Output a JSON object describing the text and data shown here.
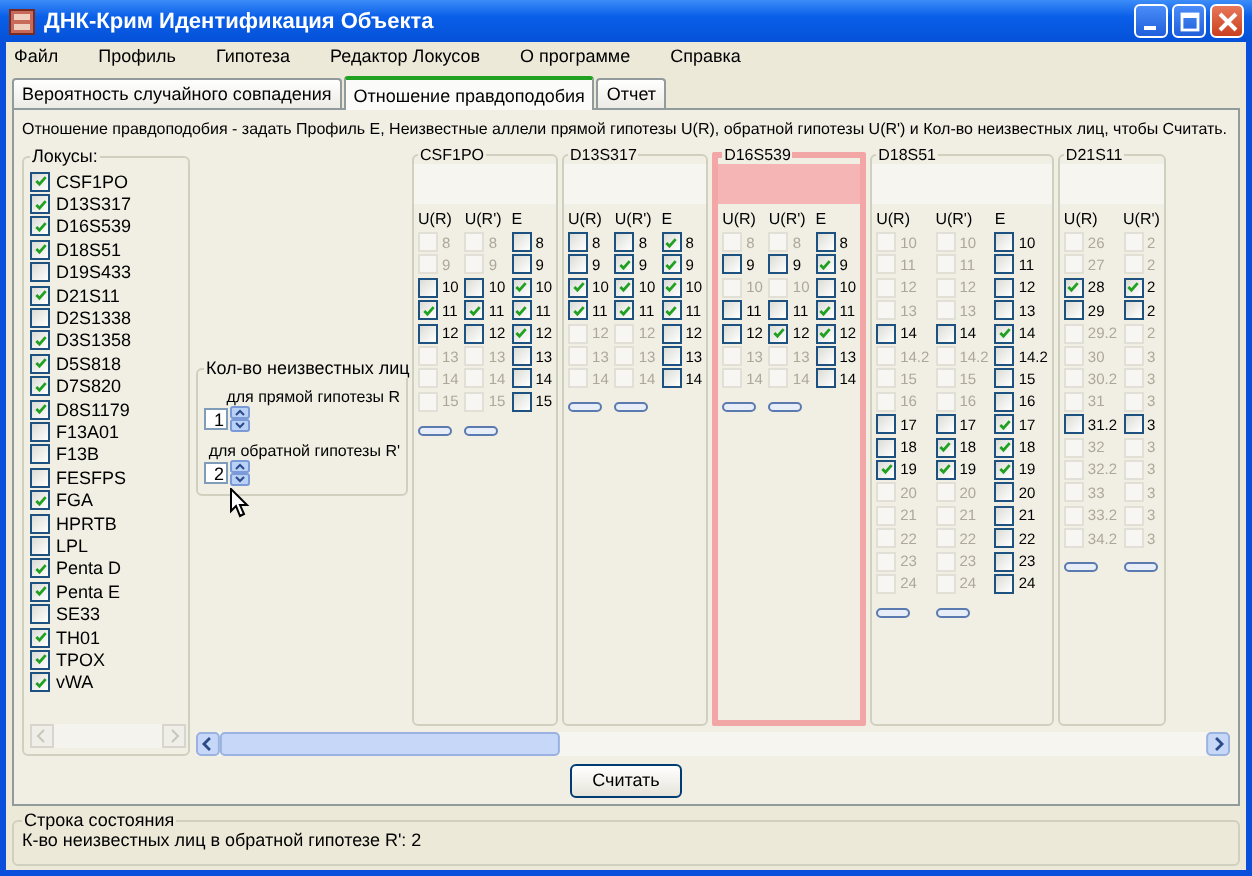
{
  "window": {
    "title": "ДНК-Крим Идентификация Объекта"
  },
  "menu": [
    "Файл",
    "Профиль",
    "Гипотеза",
    "Редактор Локусов",
    "О программе",
    "Справка"
  ],
  "tabs": [
    {
      "label": "Вероятность случайного совпадения",
      "selected": false
    },
    {
      "label": "Отношение правдоподобия",
      "selected": true
    },
    {
      "label": "Отчет",
      "selected": false
    }
  ],
  "description": "Отношение правдоподобия - задать Профиль E, Неизвестные аллели прямой гипотезы U(R), обратной гипотезы U(R') и Кол-во неизвестных лиц, чтобы Считать.",
  "loci_group": {
    "title": "Локусы:",
    "items": [
      {
        "label": "CSF1PO",
        "checked": true
      },
      {
        "label": "D13S317",
        "checked": true
      },
      {
        "label": "D16S539",
        "checked": true
      },
      {
        "label": "D18S51",
        "checked": true
      },
      {
        "label": "D19S433",
        "checked": false
      },
      {
        "label": "D21S11",
        "checked": true
      },
      {
        "label": "D2S1338",
        "checked": false
      },
      {
        "label": "D3S1358",
        "checked": true
      },
      {
        "label": "D5S818",
        "checked": true
      },
      {
        "label": "D7S820",
        "checked": true
      },
      {
        "label": "D8S1179",
        "checked": true
      },
      {
        "label": "F13A01",
        "checked": false
      },
      {
        "label": "F13B",
        "checked": false
      },
      {
        "label": "FESFPS",
        "checked": false
      },
      {
        "label": "FGA",
        "checked": true
      },
      {
        "label": "HPRTB",
        "checked": false
      },
      {
        "label": "LPL",
        "checked": false
      },
      {
        "label": "Penta D",
        "checked": true
      },
      {
        "label": "Penta E",
        "checked": true
      },
      {
        "label": "SE33",
        "checked": false
      },
      {
        "label": "TH01",
        "checked": true
      },
      {
        "label": "TPOX",
        "checked": true
      },
      {
        "label": "vWA",
        "checked": true
      }
    ]
  },
  "unknowns": {
    "title": "Кол-во неизвестных лиц",
    "fields": [
      {
        "label": "для прямой гипотезы R",
        "value": "1"
      },
      {
        "label": "для обратной гипотезы R'",
        "value": "2"
      }
    ]
  },
  "loci_panels": [
    {
      "name": "CSF1PO",
      "highlighted": false,
      "headers": [
        "U(R)",
        "U(R')",
        "E"
      ],
      "rows": [
        [
          {
            "label": "8",
            "checked": false,
            "disabled": true
          },
          {
            "label": "8",
            "checked": false,
            "disabled": true
          },
          {
            "label": "8",
            "checked": false,
            "disabled": false
          }
        ],
        [
          {
            "label": "9",
            "checked": false,
            "disabled": true
          },
          {
            "label": "9",
            "checked": false,
            "disabled": true
          },
          {
            "label": "9",
            "checked": false,
            "disabled": false
          }
        ],
        [
          {
            "label": "10",
            "checked": false,
            "disabled": false
          },
          {
            "label": "10",
            "checked": false,
            "disabled": false
          },
          {
            "label": "10",
            "checked": true,
            "disabled": false
          }
        ],
        [
          {
            "label": "11",
            "checked": true,
            "disabled": false
          },
          {
            "label": "11",
            "checked": true,
            "disabled": false
          },
          {
            "label": "11",
            "checked": true,
            "disabled": false
          }
        ],
        [
          {
            "label": "12",
            "checked": false,
            "disabled": false
          },
          {
            "label": "12",
            "checked": false,
            "disabled": false
          },
          {
            "label": "12",
            "checked": true,
            "disabled": false
          }
        ],
        [
          {
            "label": "13",
            "checked": false,
            "disabled": true
          },
          {
            "label": "13",
            "checked": false,
            "disabled": true
          },
          {
            "label": "13",
            "checked": false,
            "disabled": false
          }
        ],
        [
          {
            "label": "14",
            "checked": false,
            "disabled": true
          },
          {
            "label": "14",
            "checked": false,
            "disabled": true
          },
          {
            "label": "14",
            "checked": false,
            "disabled": false
          }
        ],
        [
          {
            "label": "15",
            "checked": false,
            "disabled": true
          },
          {
            "label": "15",
            "checked": false,
            "disabled": true
          },
          {
            "label": "15",
            "checked": false,
            "disabled": false
          }
        ]
      ]
    },
    {
      "name": "D13S317",
      "highlighted": false,
      "headers": [
        "U(R)",
        "U(R')",
        "E"
      ],
      "rows": [
        [
          {
            "label": "8",
            "checked": false,
            "disabled": false
          },
          {
            "label": "8",
            "checked": false,
            "disabled": false
          },
          {
            "label": "8",
            "checked": true,
            "disabled": false
          }
        ],
        [
          {
            "label": "9",
            "checked": false,
            "disabled": false
          },
          {
            "label": "9",
            "checked": true,
            "disabled": false
          },
          {
            "label": "9",
            "checked": true,
            "disabled": false
          }
        ],
        [
          {
            "label": "10",
            "checked": true,
            "disabled": false
          },
          {
            "label": "10",
            "checked": true,
            "disabled": false
          },
          {
            "label": "10",
            "checked": true,
            "disabled": false
          }
        ],
        [
          {
            "label": "11",
            "checked": true,
            "disabled": false
          },
          {
            "label": "11",
            "checked": true,
            "disabled": false
          },
          {
            "label": "11",
            "checked": true,
            "disabled": false
          }
        ],
        [
          {
            "label": "12",
            "checked": false,
            "disabled": true
          },
          {
            "label": "12",
            "checked": false,
            "disabled": true
          },
          {
            "label": "12",
            "checked": false,
            "disabled": false
          }
        ],
        [
          {
            "label": "13",
            "checked": false,
            "disabled": true
          },
          {
            "label": "13",
            "checked": false,
            "disabled": true
          },
          {
            "label": "13",
            "checked": false,
            "disabled": false
          }
        ],
        [
          {
            "label": "14",
            "checked": false,
            "disabled": true
          },
          {
            "label": "14",
            "checked": false,
            "disabled": true
          },
          {
            "label": "14",
            "checked": false,
            "disabled": false
          }
        ]
      ]
    },
    {
      "name": "D16S539",
      "highlighted": true,
      "headers": [
        "U(R)",
        "U(R')",
        "E"
      ],
      "rows": [
        [
          {
            "label": "8",
            "checked": false,
            "disabled": true
          },
          {
            "label": "8",
            "checked": false,
            "disabled": true
          },
          {
            "label": "8",
            "checked": false,
            "disabled": false
          }
        ],
        [
          {
            "label": "9",
            "checked": false,
            "disabled": false
          },
          {
            "label": "9",
            "checked": false,
            "disabled": false
          },
          {
            "label": "9",
            "checked": true,
            "disabled": false
          }
        ],
        [
          {
            "label": "10",
            "checked": false,
            "disabled": true
          },
          {
            "label": "10",
            "checked": false,
            "disabled": true
          },
          {
            "label": "10",
            "checked": false,
            "disabled": false
          }
        ],
        [
          {
            "label": "11",
            "checked": false,
            "disabled": false
          },
          {
            "label": "11",
            "checked": false,
            "disabled": false
          },
          {
            "label": "11",
            "checked": true,
            "disabled": false
          }
        ],
        [
          {
            "label": "12",
            "checked": false,
            "disabled": false
          },
          {
            "label": "12",
            "checked": true,
            "disabled": false
          },
          {
            "label": "12",
            "checked": true,
            "disabled": false
          }
        ],
        [
          {
            "label": "13",
            "checked": false,
            "disabled": true
          },
          {
            "label": "13",
            "checked": false,
            "disabled": true
          },
          {
            "label": "13",
            "checked": false,
            "disabled": false
          }
        ],
        [
          {
            "label": "14",
            "checked": false,
            "disabled": true
          },
          {
            "label": "14",
            "checked": false,
            "disabled": true
          },
          {
            "label": "14",
            "checked": false,
            "disabled": false
          }
        ]
      ]
    },
    {
      "name": "D18S51",
      "highlighted": false,
      "headers": [
        "U(R)",
        "U(R')",
        "E"
      ],
      "rows": [
        [
          {
            "label": "10",
            "checked": false,
            "disabled": true
          },
          {
            "label": "10",
            "checked": false,
            "disabled": true
          },
          {
            "label": "10",
            "checked": false,
            "disabled": false
          }
        ],
        [
          {
            "label": "11",
            "checked": false,
            "disabled": true
          },
          {
            "label": "11",
            "checked": false,
            "disabled": true
          },
          {
            "label": "11",
            "checked": false,
            "disabled": false
          }
        ],
        [
          {
            "label": "12",
            "checked": false,
            "disabled": true
          },
          {
            "label": "12",
            "checked": false,
            "disabled": true
          },
          {
            "label": "12",
            "checked": false,
            "disabled": false
          }
        ],
        [
          {
            "label": "13",
            "checked": false,
            "disabled": true
          },
          {
            "label": "13",
            "checked": false,
            "disabled": true
          },
          {
            "label": "13",
            "checked": false,
            "disabled": false
          }
        ],
        [
          {
            "label": "14",
            "checked": false,
            "disabled": false
          },
          {
            "label": "14",
            "checked": false,
            "disabled": false
          },
          {
            "label": "14",
            "checked": true,
            "disabled": false
          }
        ],
        [
          {
            "label": "14.2",
            "checked": false,
            "disabled": true
          },
          {
            "label": "14.2",
            "checked": false,
            "disabled": true
          },
          {
            "label": "14.2",
            "checked": false,
            "disabled": false
          }
        ],
        [
          {
            "label": "15",
            "checked": false,
            "disabled": true
          },
          {
            "label": "15",
            "checked": false,
            "disabled": true
          },
          {
            "label": "15",
            "checked": false,
            "disabled": false
          }
        ],
        [
          {
            "label": "16",
            "checked": false,
            "disabled": true
          },
          {
            "label": "16",
            "checked": false,
            "disabled": true
          },
          {
            "label": "16",
            "checked": false,
            "disabled": false
          }
        ],
        [
          {
            "label": "17",
            "checked": false,
            "disabled": false
          },
          {
            "label": "17",
            "checked": false,
            "disabled": false
          },
          {
            "label": "17",
            "checked": true,
            "disabled": false
          }
        ],
        [
          {
            "label": "18",
            "checked": false,
            "disabled": false
          },
          {
            "label": "18",
            "checked": true,
            "disabled": false
          },
          {
            "label": "18",
            "checked": true,
            "disabled": false
          }
        ],
        [
          {
            "label": "19",
            "checked": true,
            "disabled": false
          },
          {
            "label": "19",
            "checked": true,
            "disabled": false
          },
          {
            "label": "19",
            "checked": true,
            "disabled": false
          }
        ],
        [
          {
            "label": "20",
            "checked": false,
            "disabled": true
          },
          {
            "label": "20",
            "checked": false,
            "disabled": true
          },
          {
            "label": "20",
            "checked": false,
            "disabled": false
          }
        ],
        [
          {
            "label": "21",
            "checked": false,
            "disabled": true
          },
          {
            "label": "21",
            "checked": false,
            "disabled": true
          },
          {
            "label": "21",
            "checked": false,
            "disabled": false
          }
        ],
        [
          {
            "label": "22",
            "checked": false,
            "disabled": true
          },
          {
            "label": "22",
            "checked": false,
            "disabled": true
          },
          {
            "label": "22",
            "checked": false,
            "disabled": false
          }
        ],
        [
          {
            "label": "23",
            "checked": false,
            "disabled": true
          },
          {
            "label": "23",
            "checked": false,
            "disabled": true
          },
          {
            "label": "23",
            "checked": false,
            "disabled": false
          }
        ],
        [
          {
            "label": "24",
            "checked": false,
            "disabled": true
          },
          {
            "label": "24",
            "checked": false,
            "disabled": true
          },
          {
            "label": "24",
            "checked": false,
            "disabled": false
          }
        ]
      ]
    },
    {
      "name": "D21S11",
      "highlighted": false,
      "headers": [
        "U(R)",
        "U(R')"
      ],
      "rows": [
        [
          {
            "label": "26",
            "checked": false,
            "disabled": true
          },
          {
            "label": "2",
            "checked": false,
            "disabled": true
          }
        ],
        [
          {
            "label": "27",
            "checked": false,
            "disabled": true
          },
          {
            "label": "2",
            "checked": false,
            "disabled": true
          }
        ],
        [
          {
            "label": "28",
            "checked": true,
            "disabled": false
          },
          {
            "label": "2",
            "checked": true,
            "disabled": false
          }
        ],
        [
          {
            "label": "29",
            "checked": false,
            "disabled": false
          },
          {
            "label": "2",
            "checked": false,
            "disabled": false
          }
        ],
        [
          {
            "label": "29.2",
            "checked": false,
            "disabled": true
          },
          {
            "label": "2",
            "checked": false,
            "disabled": true
          }
        ],
        [
          {
            "label": "30",
            "checked": false,
            "disabled": true
          },
          {
            "label": "3",
            "checked": false,
            "disabled": true
          }
        ],
        [
          {
            "label": "30.2",
            "checked": false,
            "disabled": true
          },
          {
            "label": "3",
            "checked": false,
            "disabled": true
          }
        ],
        [
          {
            "label": "31",
            "checked": false,
            "disabled": true
          },
          {
            "label": "3",
            "checked": false,
            "disabled": true
          }
        ],
        [
          {
            "label": "31.2",
            "checked": false,
            "disabled": false
          },
          {
            "label": "3",
            "checked": false,
            "disabled": false
          }
        ],
        [
          {
            "label": "32",
            "checked": false,
            "disabled": true
          },
          {
            "label": "3",
            "checked": false,
            "disabled": true
          }
        ],
        [
          {
            "label": "32.2",
            "checked": false,
            "disabled": true
          },
          {
            "label": "3",
            "checked": false,
            "disabled": true
          }
        ],
        [
          {
            "label": "33",
            "checked": false,
            "disabled": true
          },
          {
            "label": "3",
            "checked": false,
            "disabled": true
          }
        ],
        [
          {
            "label": "33.2",
            "checked": false,
            "disabled": true
          },
          {
            "label": "3",
            "checked": false,
            "disabled": true
          }
        ],
        [
          {
            "label": "34.2",
            "checked": false,
            "disabled": true
          },
          {
            "label": "3",
            "checked": false,
            "disabled": true
          }
        ]
      ]
    }
  ],
  "calculate_button": "Считать",
  "status": {
    "title": "Строка состояния",
    "text": "К-во неизвестных лиц в обратной гипотезе R': 2"
  }
}
